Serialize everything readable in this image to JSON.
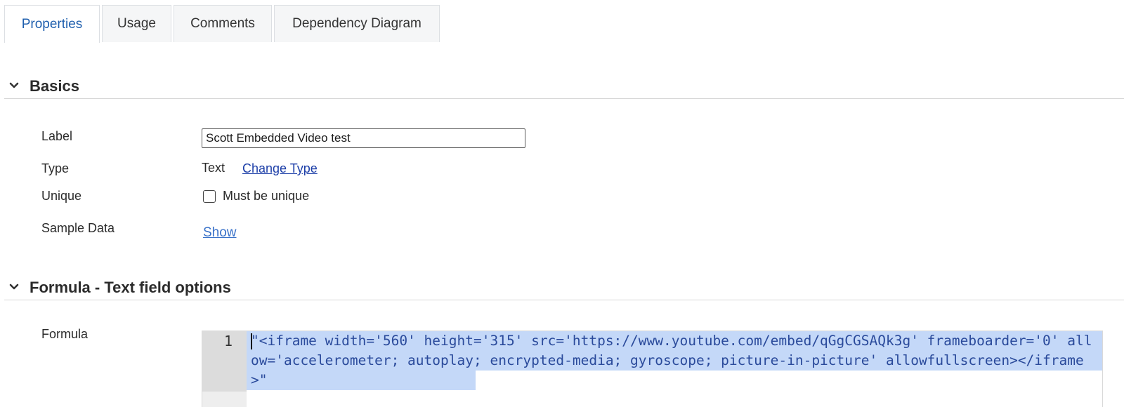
{
  "tabs": [
    {
      "label": "Properties",
      "active": true
    },
    {
      "label": "Usage",
      "active": false
    },
    {
      "label": "Comments",
      "active": false
    },
    {
      "label": "Dependency Diagram",
      "active": false
    }
  ],
  "sections": {
    "basics": {
      "title": "Basics",
      "label_row": {
        "label": "Label",
        "value": "Scott Embedded Video test"
      },
      "type_row": {
        "label": "Type",
        "value": "Text",
        "change_link": "Change Type"
      },
      "unique_row": {
        "label": "Unique",
        "checkbox_label": "Must be unique",
        "checked": false
      },
      "sample_row": {
        "label": "Sample Data",
        "show_link": "Show"
      }
    },
    "formula": {
      "title": "Formula - Text field options",
      "formula_row": {
        "label": "Formula",
        "line_number": "1",
        "code": "\"<iframe width='560' height='315' src='https://www.youtube.com/embed/qGgCGSAQk3g' frameboarder='0' allow='accelerometer; autoplay; encrypted-media; gyroscope; picture-in-picture' allowfullscreen></iframe>\""
      }
    }
  },
  "colors": {
    "active_tab_text": "#1f5fae",
    "link": "#1d3fa8",
    "selection": "#c4d8f8",
    "code_text": "#2a4a9b"
  },
  "icons": {
    "section_toggle": "chevron-down-icon"
  }
}
